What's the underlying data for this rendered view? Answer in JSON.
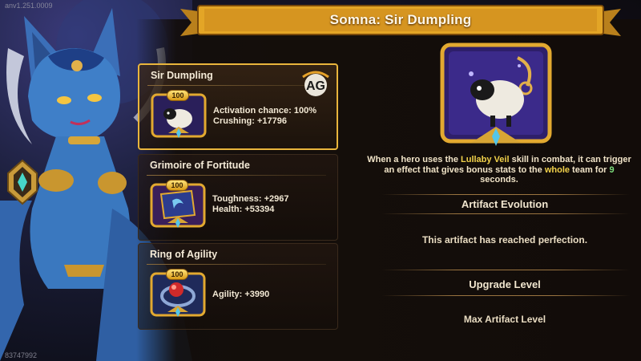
{
  "build_version": "anv1.251.0009",
  "user_id": "83747992",
  "title": "Somna: Sir Dumpling",
  "artifacts": [
    {
      "name": "Sir Dumpling",
      "level": "100",
      "stats": [
        "Activation chance: 100%",
        "Crushing: +17796"
      ],
      "icon": "sheep-icon",
      "selected": true
    },
    {
      "name": "Grimoire of Fortitude",
      "level": "100",
      "stats": [
        "Toughness: +2967",
        "Health: +53394"
      ],
      "icon": "grimoire-icon",
      "selected": false
    },
    {
      "name": "Ring of Agility",
      "level": "100",
      "stats": [
        "Agility: +3990"
      ],
      "icon": "ring-icon",
      "selected": false
    }
  ],
  "badge_logo": "AG",
  "detail": {
    "desc_before": "When a hero uses the ",
    "desc_skill": "Lullaby Veil",
    "desc_mid1": " skill in combat, it can trigger an effect that gives bonus stats to the ",
    "desc_whole": "whole",
    "desc_mid2": " team for ",
    "desc_seconds": "9",
    "desc_after": " seconds.",
    "evolution_title": "Artifact Evolution",
    "evolution_text": "This artifact has reached perfection.",
    "upgrade_title": "Upgrade Level",
    "upgrade_text": "Max Artifact Level"
  },
  "colors": {
    "gold": "#e9b53c",
    "highlight": "#f2d24b",
    "number": "#7ee07e",
    "hero_skin": "#3f7fc8"
  }
}
